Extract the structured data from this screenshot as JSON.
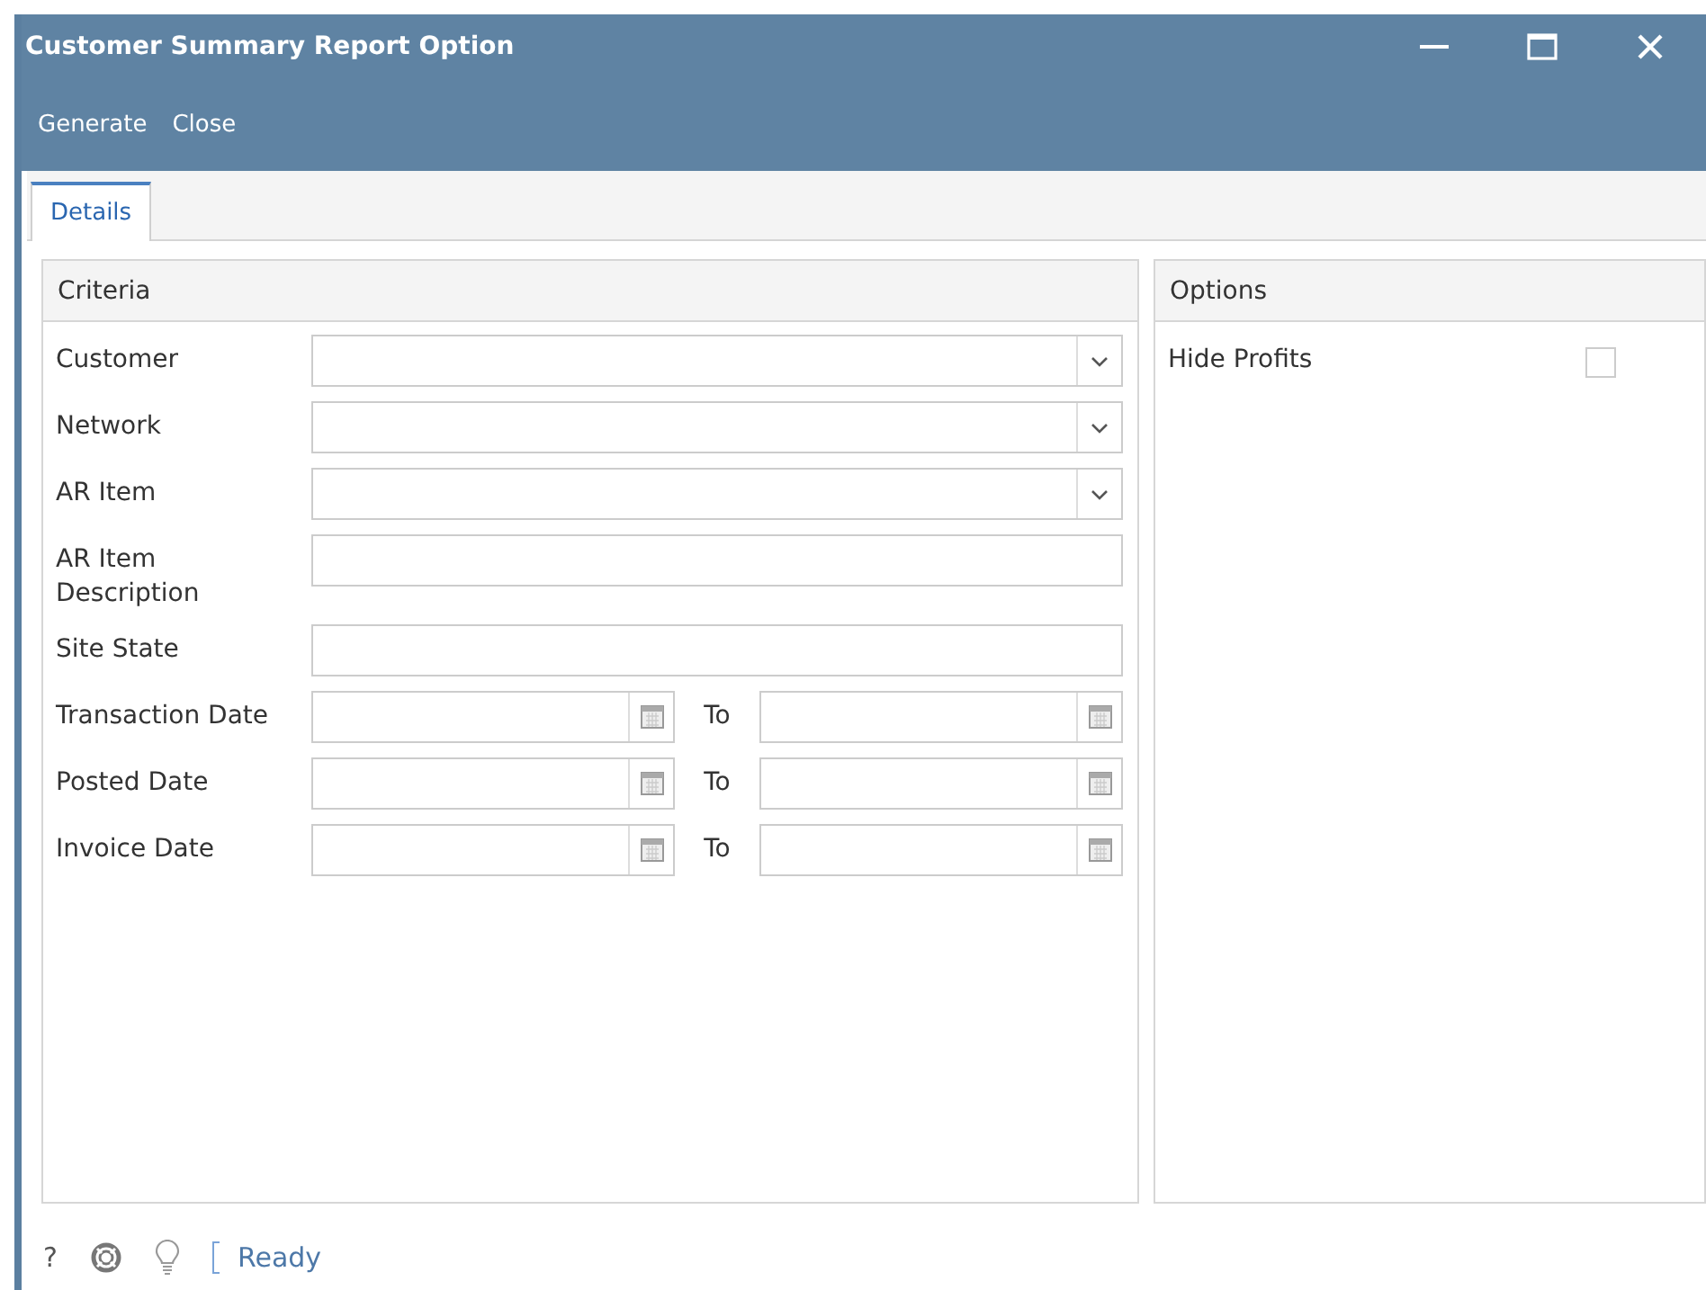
{
  "window": {
    "title": "Customer Summary Report Option"
  },
  "toolbar": [
    "Generate",
    "Close"
  ],
  "tabs": [
    {
      "label": "Details",
      "selected": true
    }
  ],
  "criteria": {
    "title": "Criteria",
    "fields": [
      {
        "label": "Customer",
        "kind": "combo"
      },
      {
        "label": "Network",
        "kind": "combo"
      },
      {
        "label": "AR Item",
        "kind": "combo"
      },
      {
        "label": "AR Item Description",
        "kind": "text"
      },
      {
        "label": "Site State",
        "kind": "text"
      },
      {
        "label": "Transaction Date",
        "kind": "daterange",
        "to_label": "To"
      },
      {
        "label": "Posted Date",
        "kind": "daterange",
        "to_label": "To"
      },
      {
        "label": "Invoice Date",
        "kind": "daterange",
        "to_label": "To"
      }
    ]
  },
  "options": {
    "title": "Options",
    "items": [
      {
        "label": "Hide Profits",
        "checked": false
      }
    ]
  },
  "status_bar": {
    "help": "?",
    "status": "Ready"
  }
}
